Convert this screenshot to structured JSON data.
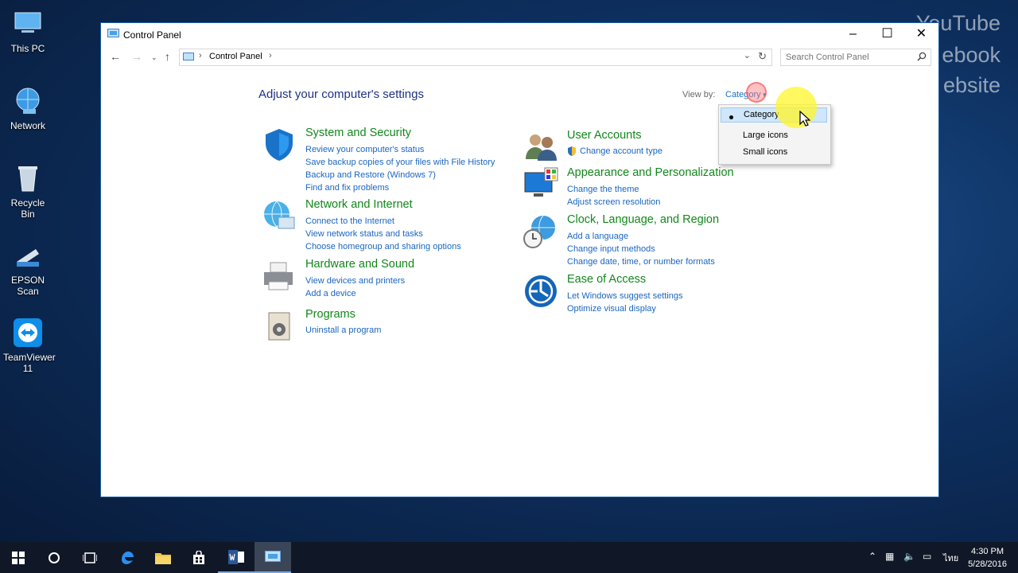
{
  "desktop": {
    "icons": [
      {
        "label": "This PC"
      },
      {
        "label": "Network"
      },
      {
        "label": "Recycle Bin"
      },
      {
        "label": "EPSON Scan"
      },
      {
        "label": "TeamViewer\n11"
      }
    ],
    "watermark": [
      "YouTube",
      "ebook",
      "ebsite"
    ]
  },
  "window": {
    "title": "Control Panel",
    "breadcrumb": "Control Panel",
    "search_placeholder": "Search Control Panel",
    "heading": "Adjust your computer's settings",
    "view_by_label": "View by:",
    "view_by_value": "Category",
    "view_options": [
      "Category",
      "Large icons",
      "Small icons"
    ],
    "categories_left": [
      {
        "title": "System and Security",
        "icon": "shield-icon",
        "links": [
          "Review your computer's status",
          "Save backup copies of your files with File History",
          "Backup and Restore (Windows 7)",
          "Find and fix problems"
        ]
      },
      {
        "title": "Network and Internet",
        "icon": "globe-network-icon",
        "links": [
          "Connect to the Internet",
          "View network status and tasks",
          "Choose homegroup and sharing options"
        ]
      },
      {
        "title": "Hardware and Sound",
        "icon": "printer-icon",
        "links": [
          "View devices and printers",
          "Add a device"
        ]
      },
      {
        "title": "Programs",
        "icon": "programs-icon",
        "links": [
          "Uninstall a program"
        ]
      }
    ],
    "categories_right": [
      {
        "title": "User Accounts",
        "icon": "users-icon",
        "links": [
          "Change account type"
        ]
      },
      {
        "title": "Appearance and Personalization",
        "icon": "monitor-palette-icon",
        "links": [
          "Change the theme",
          "Adjust screen resolution"
        ]
      },
      {
        "title": "Clock, Language, and Region",
        "icon": "clock-globe-icon",
        "links": [
          "Add a language",
          "Change input methods",
          "Change date, time, or number formats"
        ]
      },
      {
        "title": "Ease of Access",
        "icon": "ease-of-access-icon",
        "links": [
          "Let Windows suggest settings",
          "Optimize visual display"
        ]
      }
    ]
  },
  "taskbar": {
    "language": "ไทย",
    "time": "4:30 PM",
    "date": "5/28/2016"
  },
  "colors": {
    "category_title": "#12871b",
    "link": "#1a66c0",
    "heading": "#1e3287"
  }
}
